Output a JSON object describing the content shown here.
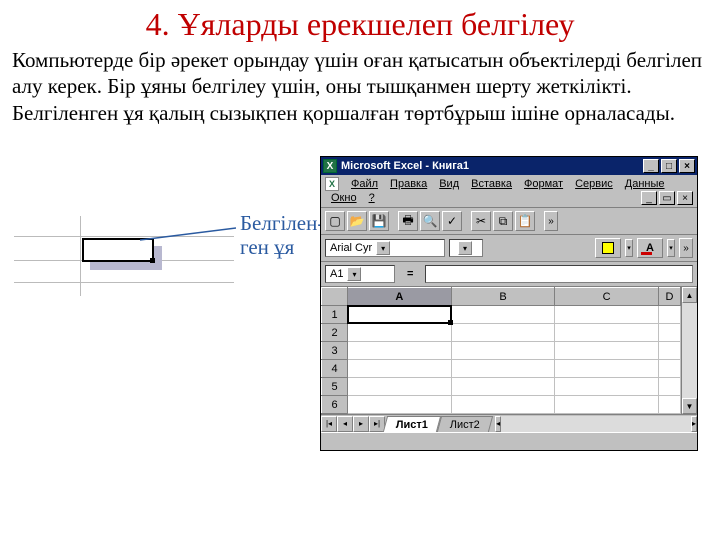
{
  "title": "4. Ұяларды ерекшелеп белгілеу",
  "body": "Компьютерде бір әрекет орындау үшін оған қатысатын объектілерді белгілеп алу керек. Бір ұяны белгілеу үшін, оны тышқанмен шерту жеткілікті. Белгіленген ұя қалың сызықпен қоршалған төртбұрыш ішіне орналасады.",
  "callout": "Белгілен-\nген ұя",
  "excel": {
    "title": "Microsoft Excel - Книга1",
    "menu": [
      "Файл",
      "Правка",
      "Вид",
      "Вставка",
      "Формат",
      "Сервис",
      "Данные",
      "Окно",
      "?"
    ],
    "font": "Arial Cyr",
    "namebox": "A1",
    "eq": "=",
    "cols": [
      "A",
      "B",
      "C",
      "D"
    ],
    "rows": [
      "1",
      "2",
      "3",
      "4",
      "5",
      "6"
    ],
    "sheets": [
      "Лист1",
      "Лист2"
    ]
  }
}
